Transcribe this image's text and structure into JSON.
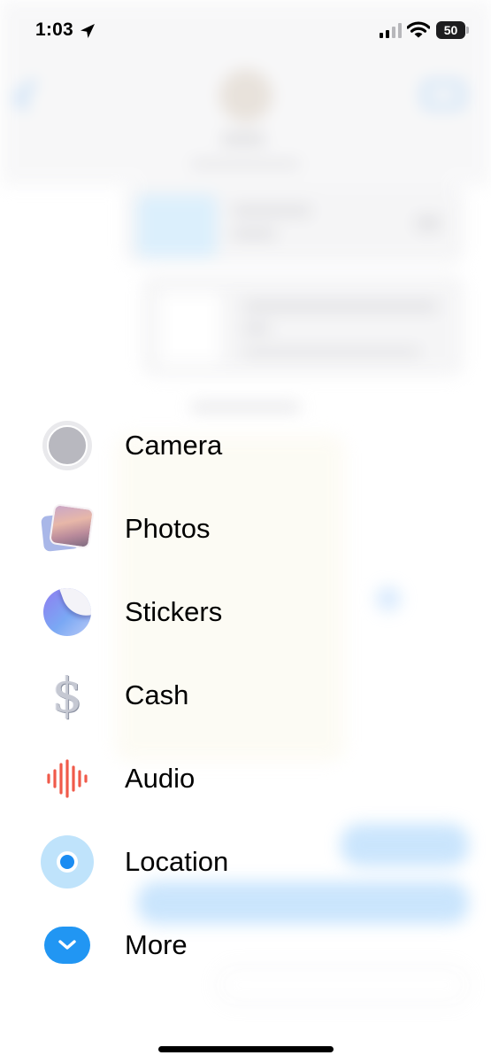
{
  "status_bar": {
    "time": "1:03",
    "battery_level": "50",
    "signal_bars_active": 2,
    "signal_bars_total": 4
  },
  "menu": {
    "items": [
      {
        "label": "Camera",
        "icon": "camera-shutter-icon"
      },
      {
        "label": "Photos",
        "icon": "photos-icon"
      },
      {
        "label": "Stickers",
        "icon": "stickers-icon"
      },
      {
        "label": "Cash",
        "icon": "cash-dollar-icon"
      },
      {
        "label": "Audio",
        "icon": "audio-waveform-icon"
      },
      {
        "label": "Location",
        "icon": "location-icon"
      },
      {
        "label": "More",
        "icon": "chevron-down-icon"
      }
    ],
    "cash_symbol": "$"
  },
  "colors": {
    "accent_blue": "#1a8cf2",
    "audio_red": "#f05a4a",
    "sticker_purple": "#8f7cf0"
  }
}
